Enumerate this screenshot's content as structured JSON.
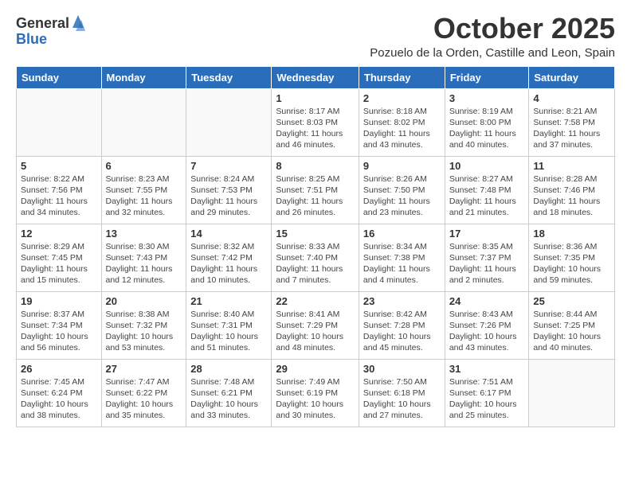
{
  "logo": {
    "general": "General",
    "blue": "Blue"
  },
  "title": "October 2025",
  "location": "Pozuelo de la Orden, Castille and Leon, Spain",
  "weekdays": [
    "Sunday",
    "Monday",
    "Tuesday",
    "Wednesday",
    "Thursday",
    "Friday",
    "Saturday"
  ],
  "weeks": [
    [
      {
        "day": "",
        "info": ""
      },
      {
        "day": "",
        "info": ""
      },
      {
        "day": "",
        "info": ""
      },
      {
        "day": "1",
        "info": "Sunrise: 8:17 AM\nSunset: 8:03 PM\nDaylight: 11 hours\nand 46 minutes."
      },
      {
        "day": "2",
        "info": "Sunrise: 8:18 AM\nSunset: 8:02 PM\nDaylight: 11 hours\nand 43 minutes."
      },
      {
        "day": "3",
        "info": "Sunrise: 8:19 AM\nSunset: 8:00 PM\nDaylight: 11 hours\nand 40 minutes."
      },
      {
        "day": "4",
        "info": "Sunrise: 8:21 AM\nSunset: 7:58 PM\nDaylight: 11 hours\nand 37 minutes."
      }
    ],
    [
      {
        "day": "5",
        "info": "Sunrise: 8:22 AM\nSunset: 7:56 PM\nDaylight: 11 hours\nand 34 minutes."
      },
      {
        "day": "6",
        "info": "Sunrise: 8:23 AM\nSunset: 7:55 PM\nDaylight: 11 hours\nand 32 minutes."
      },
      {
        "day": "7",
        "info": "Sunrise: 8:24 AM\nSunset: 7:53 PM\nDaylight: 11 hours\nand 29 minutes."
      },
      {
        "day": "8",
        "info": "Sunrise: 8:25 AM\nSunset: 7:51 PM\nDaylight: 11 hours\nand 26 minutes."
      },
      {
        "day": "9",
        "info": "Sunrise: 8:26 AM\nSunset: 7:50 PM\nDaylight: 11 hours\nand 23 minutes."
      },
      {
        "day": "10",
        "info": "Sunrise: 8:27 AM\nSunset: 7:48 PM\nDaylight: 11 hours\nand 21 minutes."
      },
      {
        "day": "11",
        "info": "Sunrise: 8:28 AM\nSunset: 7:46 PM\nDaylight: 11 hours\nand 18 minutes."
      }
    ],
    [
      {
        "day": "12",
        "info": "Sunrise: 8:29 AM\nSunset: 7:45 PM\nDaylight: 11 hours\nand 15 minutes."
      },
      {
        "day": "13",
        "info": "Sunrise: 8:30 AM\nSunset: 7:43 PM\nDaylight: 11 hours\nand 12 minutes."
      },
      {
        "day": "14",
        "info": "Sunrise: 8:32 AM\nSunset: 7:42 PM\nDaylight: 11 hours\nand 10 minutes."
      },
      {
        "day": "15",
        "info": "Sunrise: 8:33 AM\nSunset: 7:40 PM\nDaylight: 11 hours\nand 7 minutes."
      },
      {
        "day": "16",
        "info": "Sunrise: 8:34 AM\nSunset: 7:38 PM\nDaylight: 11 hours\nand 4 minutes."
      },
      {
        "day": "17",
        "info": "Sunrise: 8:35 AM\nSunset: 7:37 PM\nDaylight: 11 hours\nand 2 minutes."
      },
      {
        "day": "18",
        "info": "Sunrise: 8:36 AM\nSunset: 7:35 PM\nDaylight: 10 hours\nand 59 minutes."
      }
    ],
    [
      {
        "day": "19",
        "info": "Sunrise: 8:37 AM\nSunset: 7:34 PM\nDaylight: 10 hours\nand 56 minutes."
      },
      {
        "day": "20",
        "info": "Sunrise: 8:38 AM\nSunset: 7:32 PM\nDaylight: 10 hours\nand 53 minutes."
      },
      {
        "day": "21",
        "info": "Sunrise: 8:40 AM\nSunset: 7:31 PM\nDaylight: 10 hours\nand 51 minutes."
      },
      {
        "day": "22",
        "info": "Sunrise: 8:41 AM\nSunset: 7:29 PM\nDaylight: 10 hours\nand 48 minutes."
      },
      {
        "day": "23",
        "info": "Sunrise: 8:42 AM\nSunset: 7:28 PM\nDaylight: 10 hours\nand 45 minutes."
      },
      {
        "day": "24",
        "info": "Sunrise: 8:43 AM\nSunset: 7:26 PM\nDaylight: 10 hours\nand 43 minutes."
      },
      {
        "day": "25",
        "info": "Sunrise: 8:44 AM\nSunset: 7:25 PM\nDaylight: 10 hours\nand 40 minutes."
      }
    ],
    [
      {
        "day": "26",
        "info": "Sunrise: 7:45 AM\nSunset: 6:24 PM\nDaylight: 10 hours\nand 38 minutes."
      },
      {
        "day": "27",
        "info": "Sunrise: 7:47 AM\nSunset: 6:22 PM\nDaylight: 10 hours\nand 35 minutes."
      },
      {
        "day": "28",
        "info": "Sunrise: 7:48 AM\nSunset: 6:21 PM\nDaylight: 10 hours\nand 33 minutes."
      },
      {
        "day": "29",
        "info": "Sunrise: 7:49 AM\nSunset: 6:19 PM\nDaylight: 10 hours\nand 30 minutes."
      },
      {
        "day": "30",
        "info": "Sunrise: 7:50 AM\nSunset: 6:18 PM\nDaylight: 10 hours\nand 27 minutes."
      },
      {
        "day": "31",
        "info": "Sunrise: 7:51 AM\nSunset: 6:17 PM\nDaylight: 10 hours\nand 25 minutes."
      },
      {
        "day": "",
        "info": ""
      }
    ]
  ]
}
